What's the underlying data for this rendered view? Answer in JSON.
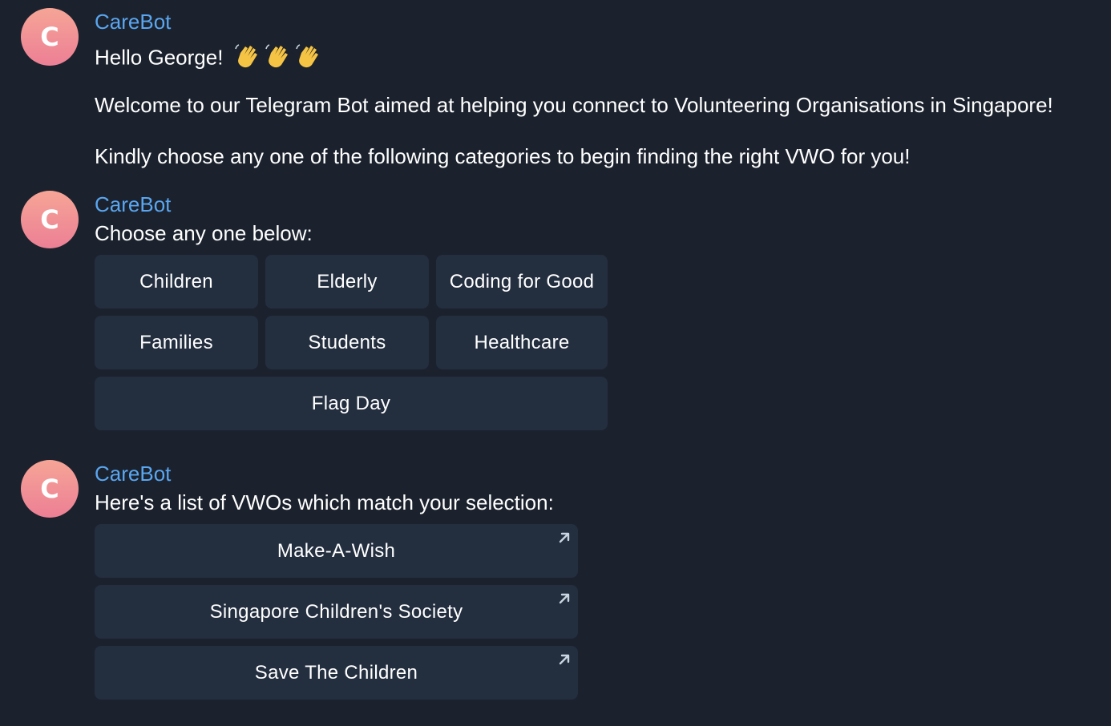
{
  "messages": [
    {
      "avatar_letter": "C",
      "sender": "CareBot",
      "greeting": "Hello George!",
      "greeting_emoji": "wave-hand-icon x3",
      "line2": "Welcome to our Telegram Bot aimed at helping you connect to Volunteering Organisations in Singapore!",
      "line3": "Kindly choose any one of the following categories to begin finding the right VWO for you!"
    },
    {
      "avatar_letter": "C",
      "sender": "CareBot",
      "text": "Choose any one below:",
      "buttons": [
        "Children",
        "Elderly",
        "Coding for Good",
        "Families",
        "Students",
        "Healthcare",
        "Flag Day"
      ]
    },
    {
      "avatar_letter": "C",
      "sender": "CareBot",
      "text": "Here's a list of VWOs which match your selection:",
      "links": [
        "Make-A-Wish",
        "Singapore Children's Society",
        "Save The Children"
      ]
    }
  ],
  "colors": {
    "background": "#1b222d",
    "sender": "#5aa6f0",
    "button": "#232e3f",
    "avatar_top": "#f6a596",
    "avatar_bottom": "#ec7f95"
  }
}
